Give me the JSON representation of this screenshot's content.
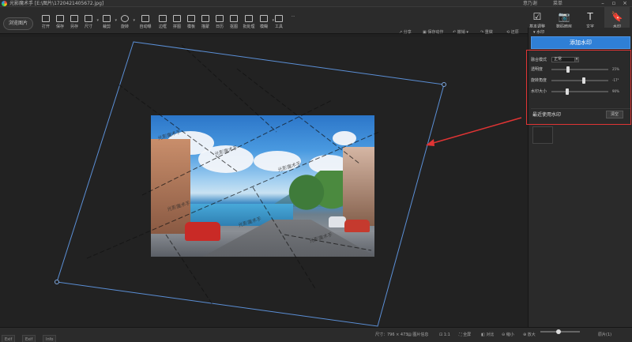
{
  "window": {
    "title": "光影魔术手 [E:\\图片\\1720421405672.jpg]",
    "top_right_1": "意乃谢",
    "top_right_2": "菜单"
  },
  "toolbar": {
    "open_label": "浏览图片",
    "items": [
      "打开",
      "保存",
      "另存",
      "尺寸",
      "裁剪",
      "旋转",
      "自动曝",
      "边框",
      "拼图",
      "模板",
      "描蒙",
      "日历",
      "抠图",
      "批处理",
      "模糊",
      "工具"
    ],
    "more": "···",
    "right_tabs": [
      "基本调整",
      "数码暗房",
      "文字",
      "水印"
    ],
    "right_icons": [
      "☑",
      "📷",
      "T",
      "🔖"
    ]
  },
  "subbar": {
    "items": [
      "分享",
      "保存动作",
      "撤销",
      "重做",
      "还原"
    ]
  },
  "panel": {
    "section_title": "水印",
    "add_button": "添加水印",
    "blend_mode_label": "融合模式",
    "blend_mode_value": "正常",
    "opacity_label": "透明度",
    "opacity_value": "25%",
    "rotation_label": "旋转角度",
    "rotation_value": "-17°",
    "size_label": "水印大小",
    "size_value": "90%",
    "recent_label": "最近使用水印",
    "clear_button": "清空"
  },
  "watermark_text": "光影魔术手",
  "statusbar": {
    "size_label": "尺寸：796 × 473",
    "info": "图片信息",
    "ratio": "1:1",
    "fullscreen": "全屏",
    "compare": "对比",
    "zoom_out": "缩小",
    "zoom_in": "放大",
    "page": "原片(1)",
    "tabs": [
      "Exif",
      "Exif",
      "Info"
    ]
  },
  "colors": {
    "accent": "#2f7fd6",
    "highlight": "#e03434",
    "selection": "#5b8fd6"
  }
}
